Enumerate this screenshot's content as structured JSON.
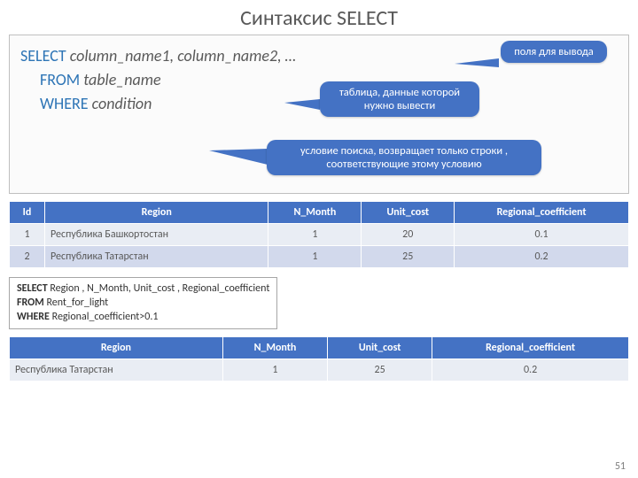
{
  "title": "Синтаксис SELECT",
  "syntax": {
    "kw_select": "SELECT",
    "select_cols": "column_name1, column_name2, …",
    "kw_from": "FROM",
    "from_arg": "table_name",
    "kw_where": "WHERE",
    "where_arg": "condition"
  },
  "callouts": {
    "fields": "поля для вывода",
    "table": "таблица, данные которой нужно вывести",
    "condition": "условие поиска, возвращает  только строки , соответствующие этому условию"
  },
  "table1": {
    "headers": [
      "Id",
      "Region",
      "N_Month",
      "Unit_cost",
      "Regional_coefficient"
    ],
    "rows": [
      {
        "id": "1",
        "region": "Республика Башкортостан",
        "n_month": "1",
        "unit_cost": "20",
        "coef": "0.1"
      },
      {
        "id": "2",
        "region": "Республика Татарстан",
        "n_month": "1",
        "unit_cost": "25",
        "coef": "0.2"
      }
    ]
  },
  "query": {
    "kw_select": "SELECT",
    "select_cols": " Region , N_Month, Unit_cost , Regional_coefficient",
    "kw_from": "FROM",
    "from_arg": " Rent_for_light",
    "kw_where": "WHERE",
    "where_arg": " Regional_coefficient>0.1"
  },
  "table2": {
    "headers": [
      "Region",
      "N_Month",
      "Unit_cost",
      "Regional_coefficient"
    ],
    "rows": [
      {
        "region": "Республика Татарстан",
        "n_month": "1",
        "unit_cost": "25",
        "coef": "0.2"
      }
    ]
  },
  "page_number": "51"
}
